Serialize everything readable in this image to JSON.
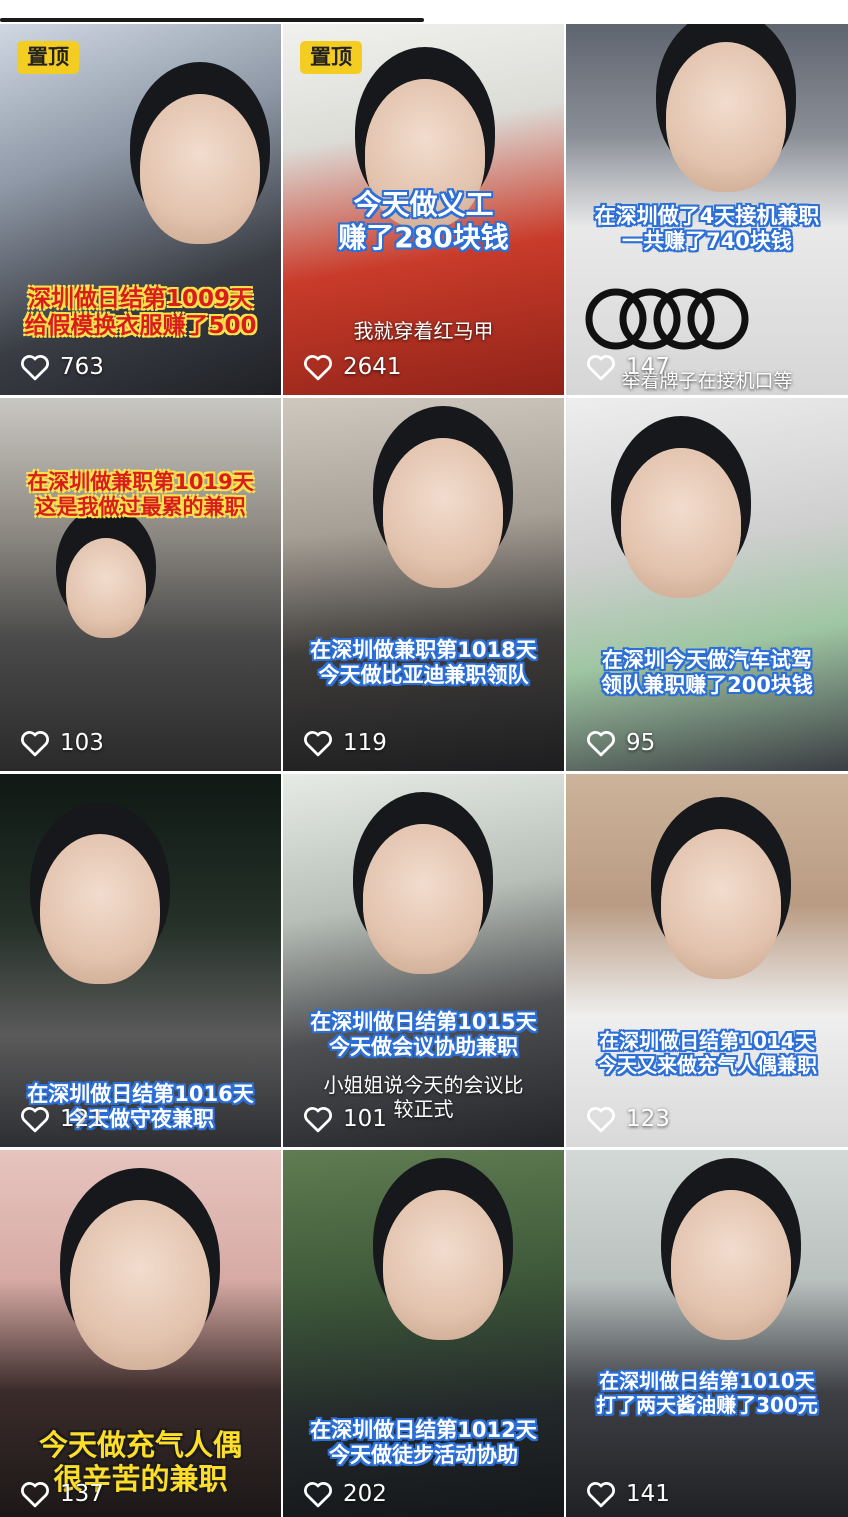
{
  "feed": {
    "pinned_label": "置顶",
    "videos": [
      {
        "pinned": true,
        "caption": [
          "深圳做日结第1009天",
          "给假模换衣服赚了500"
        ],
        "likes": "763"
      },
      {
        "pinned": true,
        "caption": [
          "今天做义工",
          "赚了280块钱"
        ],
        "subcaption": "我就穿着红马甲",
        "likes": "2641"
      },
      {
        "pinned": false,
        "caption": [
          "在深圳做了4天接机兼职",
          "一共赚了740块钱"
        ],
        "subcaption": "举着牌子在接机口等",
        "likes": "147"
      },
      {
        "pinned": false,
        "caption": [
          "在深圳做兼职第1019天",
          "这是我做过最累的兼职"
        ],
        "likes": "103"
      },
      {
        "pinned": false,
        "caption": [
          "在深圳做兼职第1018天",
          "今天做比亚迪兼职领队"
        ],
        "likes": "119"
      },
      {
        "pinned": false,
        "caption": [
          "在深圳今天做汽车试驾",
          "领队兼职赚了200块钱"
        ],
        "likes": "95"
      },
      {
        "pinned": false,
        "caption": [
          "在深圳做日结第1016天",
          "今天做守夜兼职"
        ],
        "likes": "121"
      },
      {
        "pinned": false,
        "caption": [
          "在深圳做日结第1015天",
          "今天做会议协助兼职"
        ],
        "subcaption": "小姐姐说今天的会议比较正式",
        "likes": "101"
      },
      {
        "pinned": false,
        "caption": [
          "在深圳做日结第1014天",
          "今天又来做充气人偶兼职"
        ],
        "likes": "123"
      },
      {
        "pinned": false,
        "caption": [
          "今天做充气人偶",
          "很辛苦的兼职"
        ],
        "likes": "137"
      },
      {
        "pinned": false,
        "caption": [
          "在深圳做日结第1012天",
          "今天做徒步活动协助"
        ],
        "likes": "202"
      },
      {
        "pinned": false,
        "caption": [
          "在深圳做日结第1010天",
          "打了两天酱油赚了300元"
        ],
        "likes": "141"
      }
    ]
  },
  "icons": {
    "like": "heart-outline-icon"
  },
  "colors": {
    "pin_badge": "#f4cd22",
    "caption_outline_blue": "#2c6fd6",
    "caption_red": "#d81d1d"
  }
}
